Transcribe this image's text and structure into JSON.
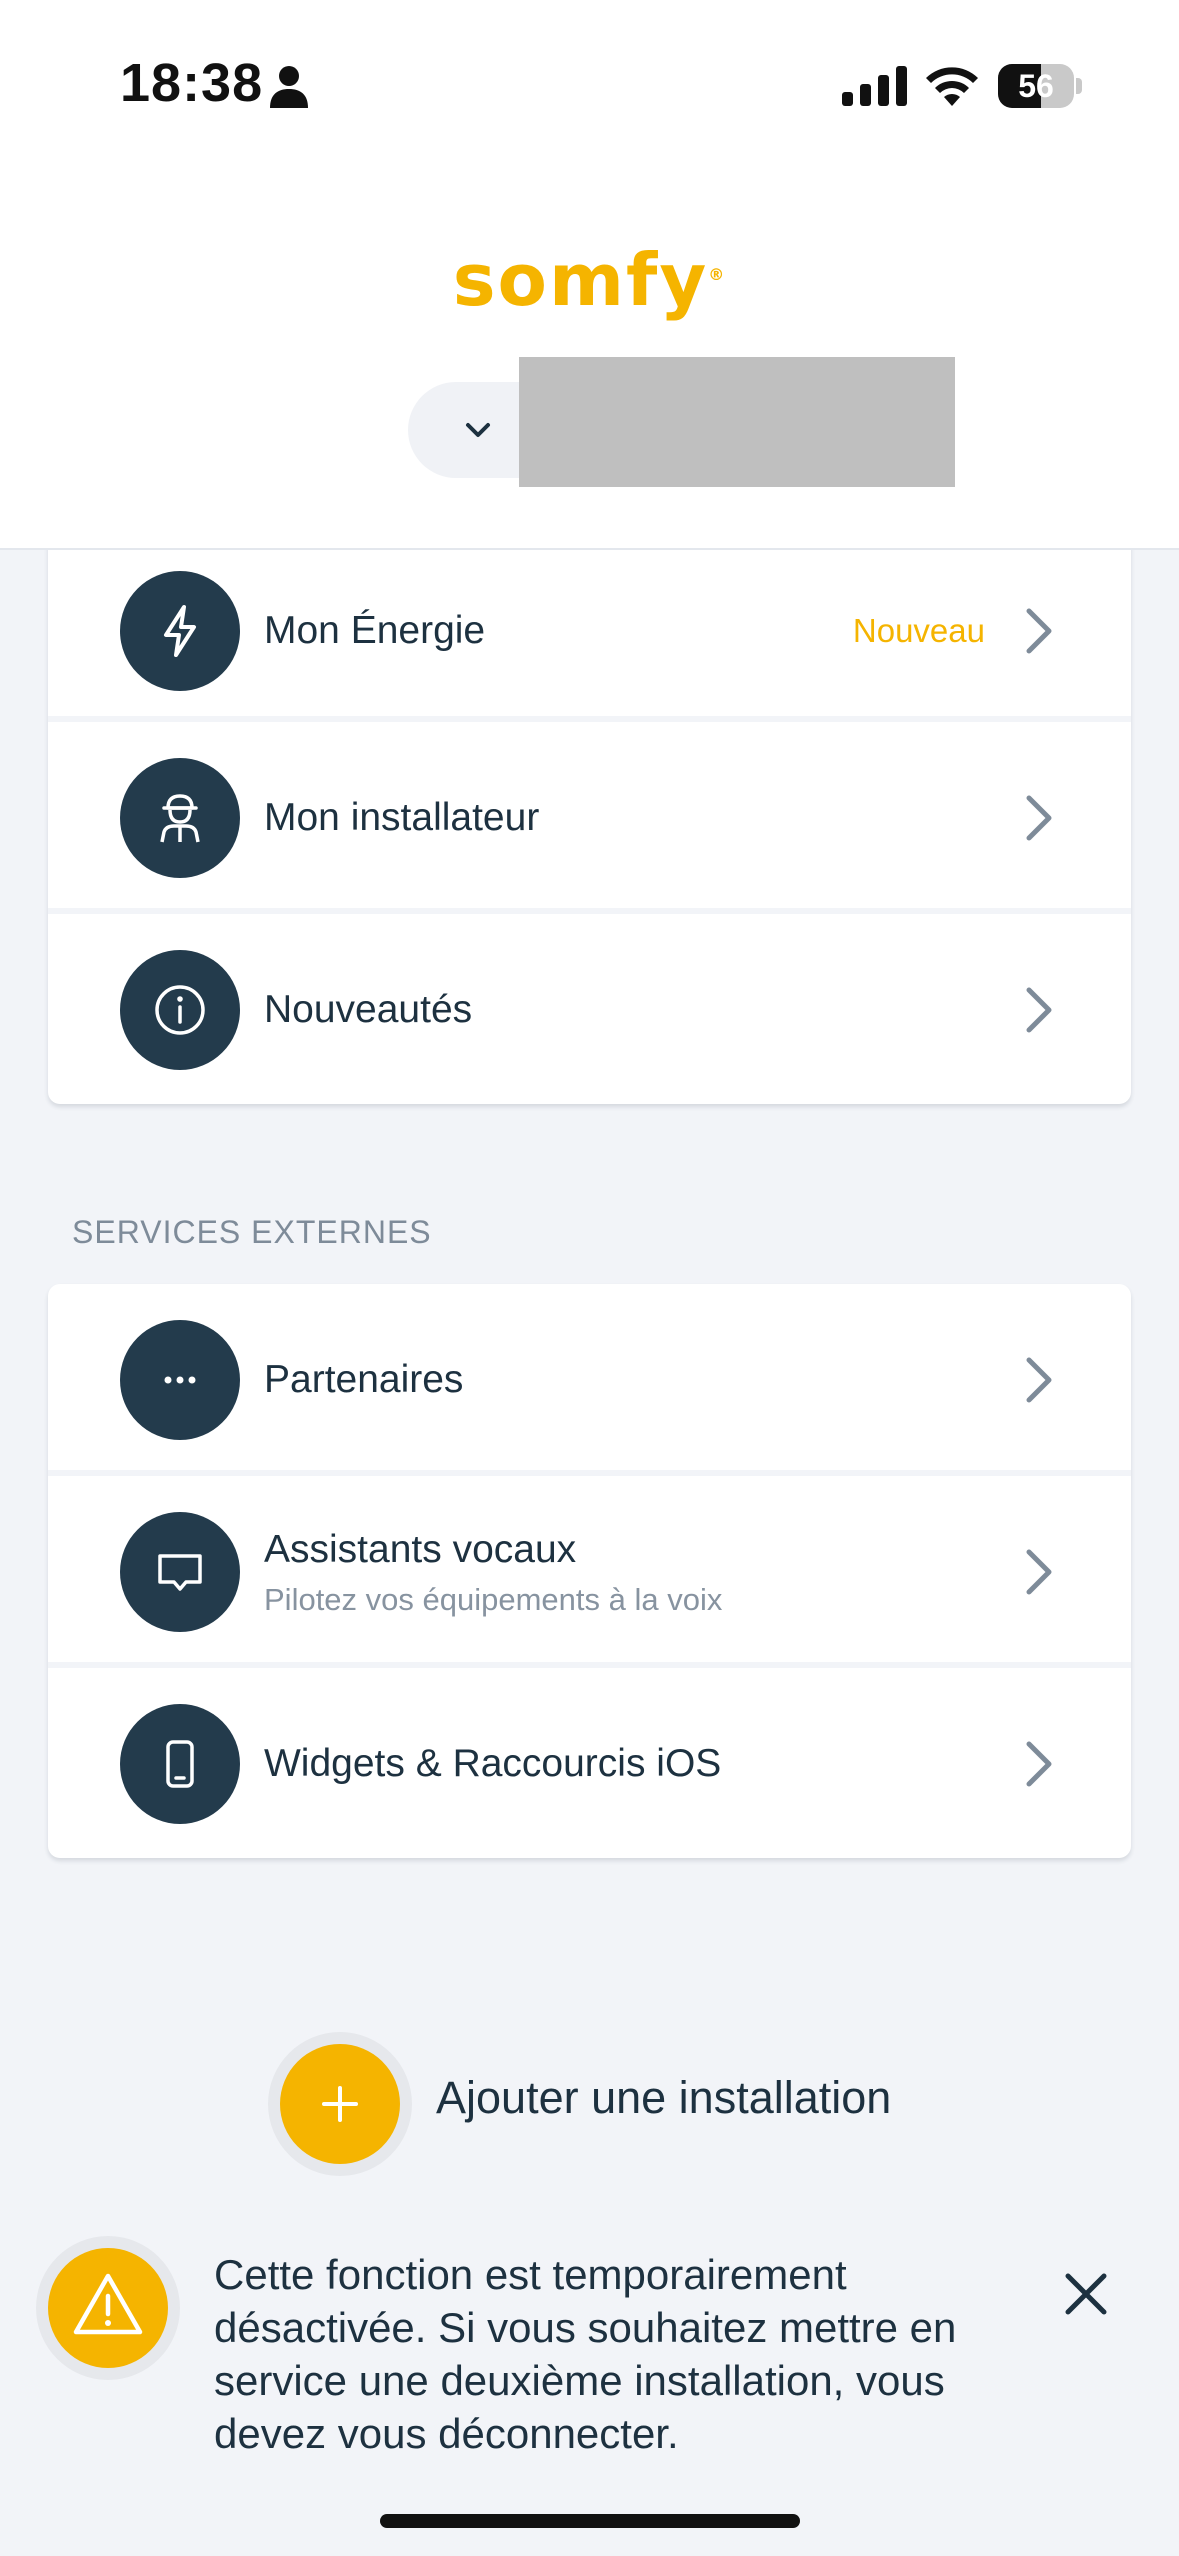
{
  "status_bar": {
    "time": "18:38",
    "battery_level": "56",
    "battery_percent": 56
  },
  "header": {
    "logo_text": "somfy",
    "logo_mark": "®"
  },
  "account_menu": {
    "items": [
      {
        "label": "Mon Énergie",
        "badge": "Nouveau",
        "icon": "lightning-icon"
      },
      {
        "label": "Mon installateur",
        "icon": "installer-icon"
      },
      {
        "label": "Nouveautés",
        "icon": "info-icon"
      }
    ]
  },
  "external_services": {
    "section_title": "SERVICES EXTERNES",
    "items": [
      {
        "label": "Partenaires",
        "icon": "more-icon"
      },
      {
        "label": "Assistants vocaux",
        "sublabel": "Pilotez vos équipements à la voix",
        "icon": "speech-bubble-icon"
      },
      {
        "label": "Widgets & Raccourcis iOS",
        "icon": "phone-icon"
      }
    ]
  },
  "add_installation": {
    "label": "Ajouter une installation",
    "icon": "plus-icon"
  },
  "toast": {
    "icon": "warning-icon",
    "message": "Cette fonction est temporairement désactivée. Si vous souhaitez mettre en service une deuxième installation, vous devez vous déconnecter."
  },
  "colors": {
    "accent": "#f5b400",
    "icon_circle": "#233b4c",
    "text": "#1d3140",
    "background": "#f2f4f8"
  }
}
